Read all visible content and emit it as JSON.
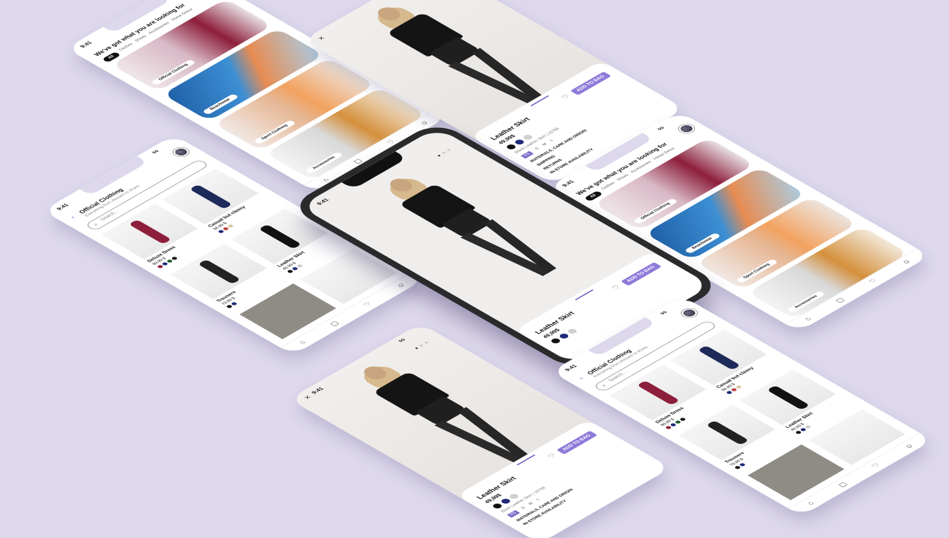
{
  "status": {
    "time": "9:41",
    "signal": "5G"
  },
  "home": {
    "title": "We've got what you are looking for",
    "tabs": [
      "All",
      "Clothes",
      "Shoes",
      "Accessories",
      "Home Decor"
    ],
    "cards": [
      "Official Clothing",
      "Beachwear",
      "Sport Clothing",
      "Accessories"
    ]
  },
  "product": {
    "name": "Leather Skirt",
    "price": "49,99$",
    "description": "Black Leather Skirt | 15768",
    "sizes": [
      "XS",
      "S",
      "M",
      "L"
    ],
    "selected_size": "XS",
    "add_to_bag": "ADD TO BAG",
    "links": [
      "MATERIALS, CARE AND ORIGIN",
      "SHIPPING",
      "RETURNS",
      "IN-STORE AVAILABILITY"
    ],
    "swatch_colors": [
      "#111111",
      "#1e2a78",
      "#cfcfcf"
    ]
  },
  "listing": {
    "title": "Official Clothing",
    "subtitle": "Everything from dresses to shoes",
    "search_placeholder": "Search...",
    "items": [
      {
        "name": "Deluxe Dress",
        "price": "89,99 $"
      },
      {
        "name": "Casual but classy",
        "price": "56,99 $"
      },
      {
        "name": "Trousers",
        "price": "79,99 $"
      },
      {
        "name": "Leather Skirt",
        "price": "49,99 $"
      }
    ]
  },
  "colors": {
    "background": "#ddd8ec",
    "accent": "#8f7ad9"
  },
  "icons": {
    "home": "home-icon",
    "bag": "bag-icon",
    "heart": "heart-icon",
    "user": "user-icon",
    "search": "search-icon",
    "close": "close-icon",
    "back": "back-icon"
  }
}
